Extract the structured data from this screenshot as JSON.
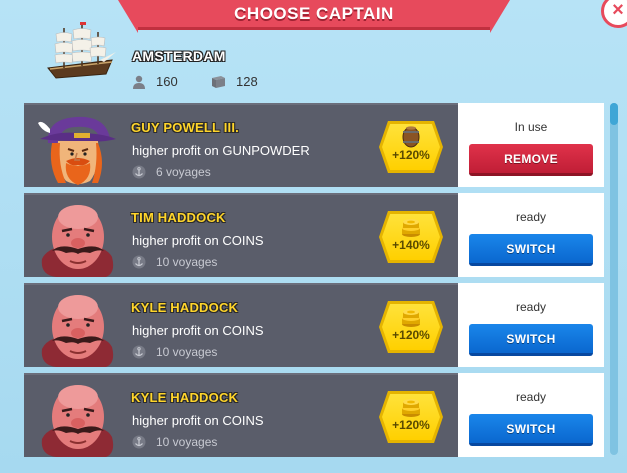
{
  "header": {
    "title": "CHOOSE CAPTAIN",
    "close_label": "×"
  },
  "ship": {
    "name": "AMSTERDAM",
    "crew": "160",
    "cargo": "128",
    "icon": "ship-icon"
  },
  "captains": [
    {
      "name": "GUY POWELL III.",
      "description": "higher profit on GUNPOWDER",
      "voyages": "6 voyages",
      "bonus": "+120%",
      "bonus_icon": "barrel-icon",
      "status": "In use",
      "action": "REMOVE",
      "action_type": "remove"
    },
    {
      "name": "TIM HADDOCK",
      "description": "higher profit on COINS",
      "voyages": "10 voyages",
      "bonus": "+140%",
      "bonus_icon": "coins-icon",
      "status": "ready",
      "action": "SWITCH",
      "action_type": "switch"
    },
    {
      "name": "KYLE HADDOCK",
      "description": "higher profit on COINS",
      "voyages": "10 voyages",
      "bonus": "+120%",
      "bonus_icon": "coins-icon",
      "status": "ready",
      "action": "SWITCH",
      "action_type": "switch"
    },
    {
      "name": "KYLE HADDOCK",
      "description": "higher profit on COINS",
      "voyages": "10 voyages",
      "bonus": "+120%",
      "bonus_icon": "coins-icon",
      "status": "ready",
      "action": "SWITCH",
      "action_type": "switch"
    }
  ],
  "colors": {
    "banner": "#e74a5c",
    "remove": "#d42840",
    "switch": "#1279de",
    "badge": "#ffd000",
    "name": "#ffd52b"
  }
}
